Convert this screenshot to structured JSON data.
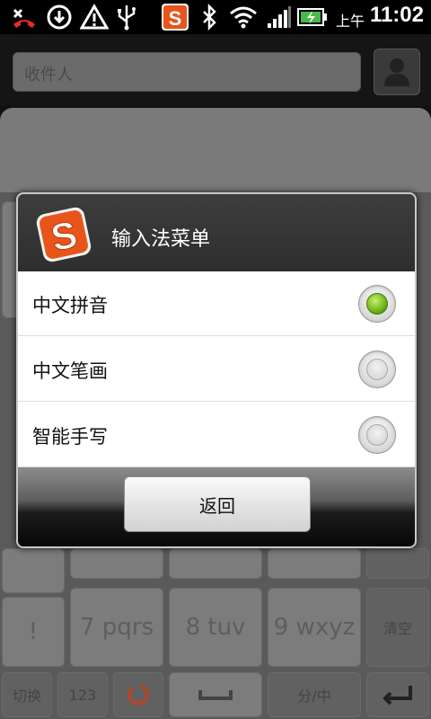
{
  "status_bar": {
    "icons": [
      "missed-call-icon",
      "download-icon",
      "warning-icon",
      "usb-icon",
      "sogou-app-icon",
      "bluetooth-icon",
      "wifi-icon",
      "signal-icon",
      "battery-charging-icon"
    ],
    "ampm": "上午",
    "time": "11:02"
  },
  "background_app": {
    "recipient_placeholder": "收件人",
    "keyboard_keys": [
      "7 pqrs",
      "8 tuv",
      "9 wxyz",
      "清空",
      "切换",
      "123",
      "分/中"
    ]
  },
  "dialog": {
    "title": "输入法菜单",
    "options": [
      {
        "label": "中文拼音",
        "selected": true
      },
      {
        "label": "中文笔画",
        "selected": false
      },
      {
        "label": "智能手写",
        "selected": false
      }
    ],
    "back_button": "返回"
  },
  "colors": {
    "accent_green": "#6cb418",
    "logo_orange": "#e8551b"
  }
}
